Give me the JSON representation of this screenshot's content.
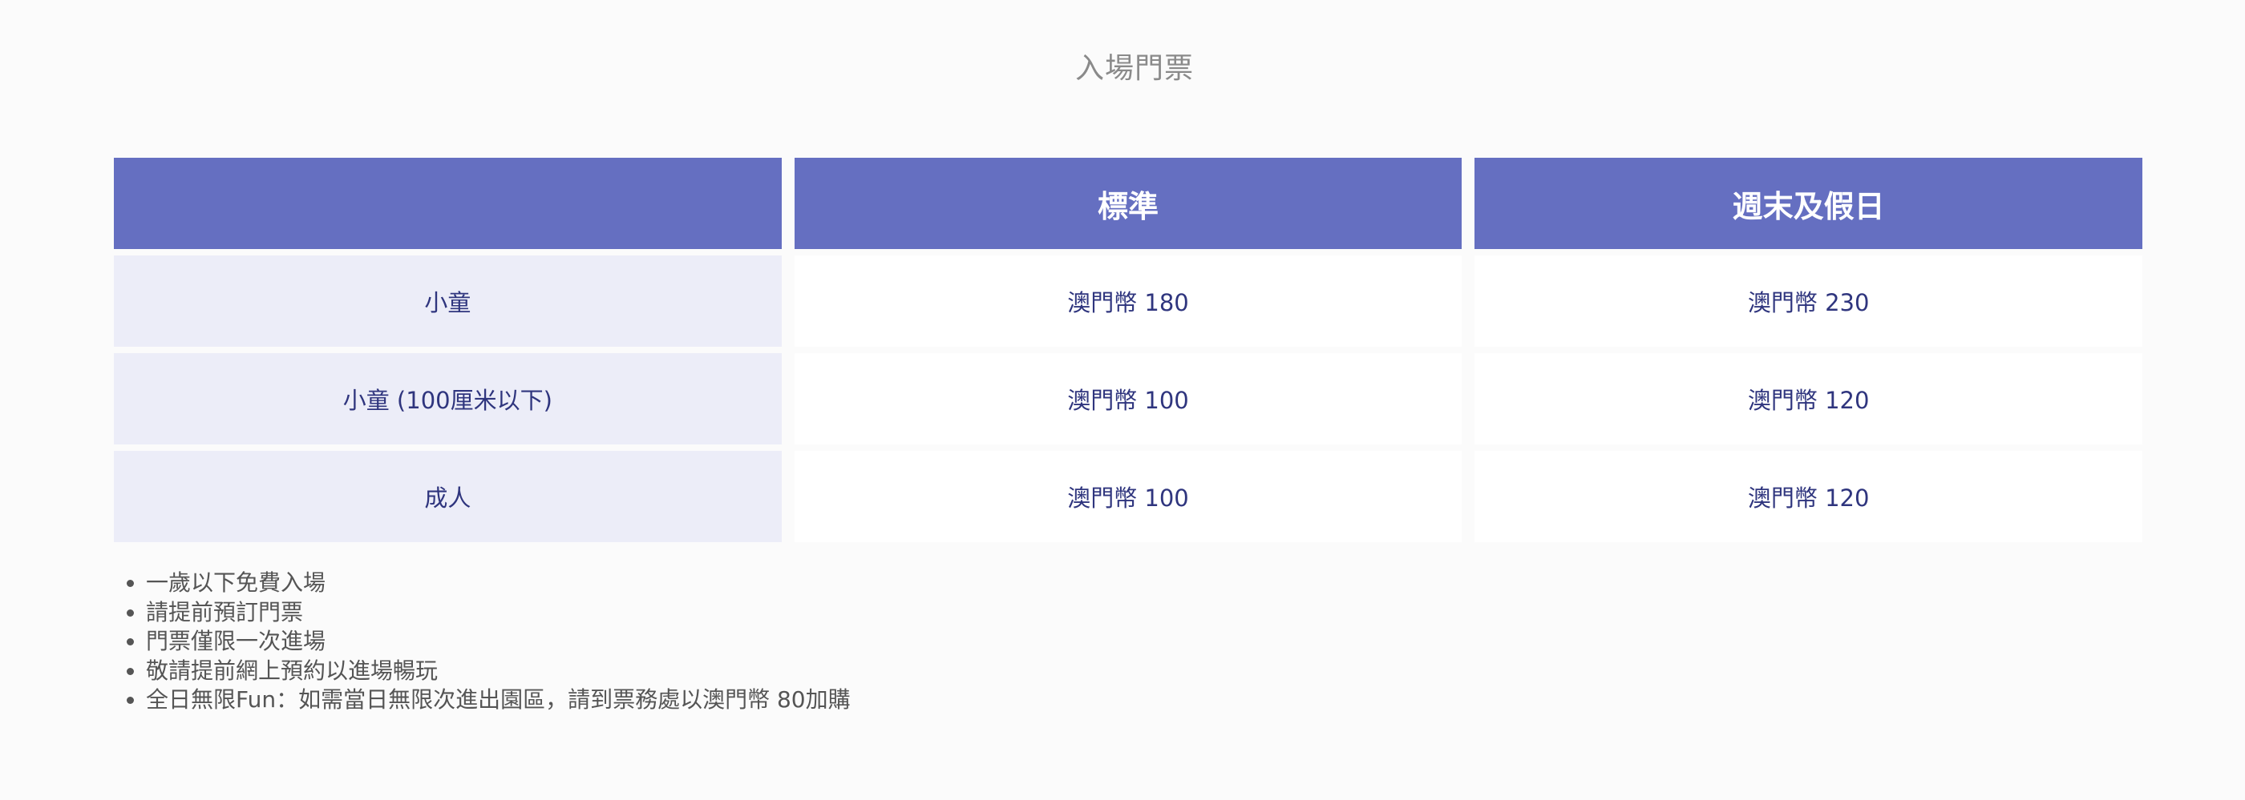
{
  "page_title": "入場門票",
  "table": {
    "headers": [
      "",
      "標準",
      "週末及假日"
    ],
    "rows": [
      {
        "label": "小童",
        "standard": "澳門幣 180",
        "weekend": "澳門幣 230"
      },
      {
        "label": "小童 (100厘米以下)",
        "standard": "澳門幣 100",
        "weekend": "澳門幣 120"
      },
      {
        "label": "成人",
        "standard": "澳門幣 100",
        "weekend": "澳門幣 120"
      }
    ]
  },
  "notes": [
    "一歲以下免費入場",
    "請提前預訂門票",
    "門票僅限一次進場",
    "敬請提前網上預約以進場暢玩",
    "全日無限Fun：如需當日無限次進出園區，請到票務處以澳門幣 80加購"
  ],
  "colors": {
    "header_bg": "#656fc1",
    "row_label_bg": "#ecedf8",
    "cell_text": "#2f357e",
    "title_text": "#8a8a8a"
  }
}
